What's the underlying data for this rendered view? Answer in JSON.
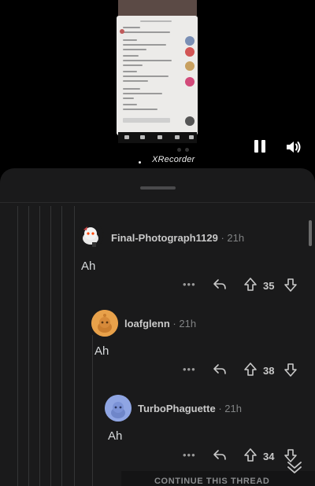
{
  "recorder": {
    "watermark": "XRecorder"
  },
  "comments": [
    {
      "author": "Final-Photograph1129",
      "separator": "·",
      "time": "21h",
      "body": "Ah",
      "more": "•••",
      "score": "35"
    },
    {
      "author": "loafglenn",
      "separator": "·",
      "time": "21h",
      "body": "Ah",
      "more": "•••",
      "score": "38"
    },
    {
      "author": "TurboPhaguette",
      "separator": "·",
      "time": "21h",
      "body": "Ah",
      "more": "•••",
      "score": "34"
    }
  ],
  "thread": {
    "continue_label": "CONTINUE THIS THREAD"
  },
  "icons": {
    "pause": "pause-icon",
    "volume": "volume-icon",
    "reply": "reply-icon",
    "upvote": "upvote-icon",
    "downvote": "downvote-icon",
    "more": "more-icon",
    "collapse": "chevron-double-down-icon"
  },
  "colors": {
    "sheet": "#1a1a1b",
    "text": "#d7dadc",
    "meta": "#818384",
    "avatar_orange": "#e8a14a",
    "avatar_blue": "#8fa5e3"
  }
}
